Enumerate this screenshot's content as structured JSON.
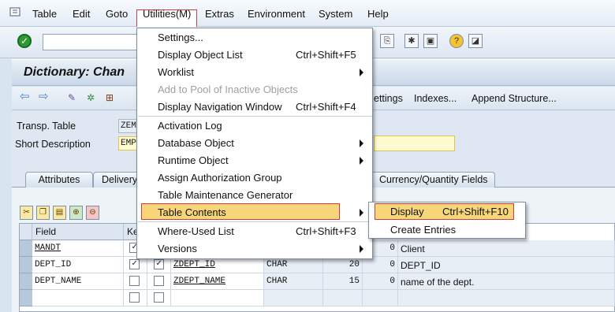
{
  "menubar": {
    "items": [
      "Table",
      "Edit",
      "Goto",
      "Utilities(M)",
      "Extras",
      "Environment",
      "System",
      "Help"
    ]
  },
  "header": {
    "title": "Dictionary: Chan"
  },
  "toolbar2": {
    "buttons": [
      "ettings",
      "Indexes...",
      "Append Structure..."
    ]
  },
  "fields": {
    "transp_table_label": "Transp. Table",
    "transp_table_value": "ZEM",
    "short_desc_label": "Short Description",
    "short_desc_value": "EMP"
  },
  "tabs": [
    "Attributes",
    "Delivery",
    "Currency/Quantity Fields"
  ],
  "table": {
    "headers": [
      "Field",
      "Ke"
    ],
    "rows": [
      {
        "field": "MANDT",
        "key": true,
        "init": true,
        "data_element": "",
        "data_type": "",
        "length": "",
        "decimals": "0",
        "description": "Client"
      },
      {
        "field": "DEPT_ID",
        "key": true,
        "init": true,
        "data_element": "ZDEPT_ID",
        "data_type": "CHAR",
        "length": "20",
        "decimals": "0",
        "description": "DEPT_ID"
      },
      {
        "field": "DEPT_NAME",
        "key": false,
        "init": false,
        "data_element": "ZDEPT_NAME",
        "data_type": "CHAR",
        "length": "15",
        "decimals": "0",
        "description": "name of the dept."
      },
      {
        "field": "",
        "key": false,
        "init": false,
        "data_element": "",
        "data_type": "",
        "length": "",
        "decimals": "",
        "description": ""
      }
    ]
  },
  "utilities_menu": {
    "items": [
      {
        "label": "Settings...",
        "shortcut": "",
        "submenu": false,
        "disabled": false
      },
      {
        "label": "Display Object List",
        "shortcut": "Ctrl+Shift+F5",
        "submenu": false,
        "disabled": false
      },
      {
        "label": "Worklist",
        "shortcut": "",
        "submenu": true,
        "disabled": false
      },
      {
        "label": "Add to Pool of Inactive Objects",
        "shortcut": "",
        "submenu": false,
        "disabled": true
      },
      {
        "label": "Display Navigation Window",
        "shortcut": "Ctrl+Shift+F4",
        "submenu": false,
        "disabled": false
      },
      {
        "label": "Activation Log",
        "shortcut": "",
        "submenu": false,
        "disabled": false
      },
      {
        "label": "Database Object",
        "shortcut": "",
        "submenu": true,
        "disabled": false
      },
      {
        "label": "Runtime Object",
        "shortcut": "",
        "submenu": true,
        "disabled": false
      },
      {
        "label": "Assign Authorization Group",
        "shortcut": "",
        "submenu": false,
        "disabled": false
      },
      {
        "label": "Table Maintenance Generator",
        "shortcut": "",
        "submenu": false,
        "disabled": false
      },
      {
        "label": "Table Contents",
        "shortcut": "",
        "submenu": true,
        "disabled": false
      },
      {
        "label": "Where-Used List",
        "shortcut": "Ctrl+Shift+F3",
        "submenu": false,
        "disabled": false
      },
      {
        "label": "Versions",
        "shortcut": "",
        "submenu": true,
        "disabled": false
      }
    ]
  },
  "table_contents_submenu": {
    "items": [
      {
        "label": "Display",
        "shortcut": "Ctrl+Shift+F10"
      },
      {
        "label": "Create Entries",
        "shortcut": ""
      }
    ]
  },
  "colors": {
    "highlight_border": "#d23c3c",
    "highlight_fill": "#f7d67a",
    "menu_bg": "#ffffff"
  }
}
